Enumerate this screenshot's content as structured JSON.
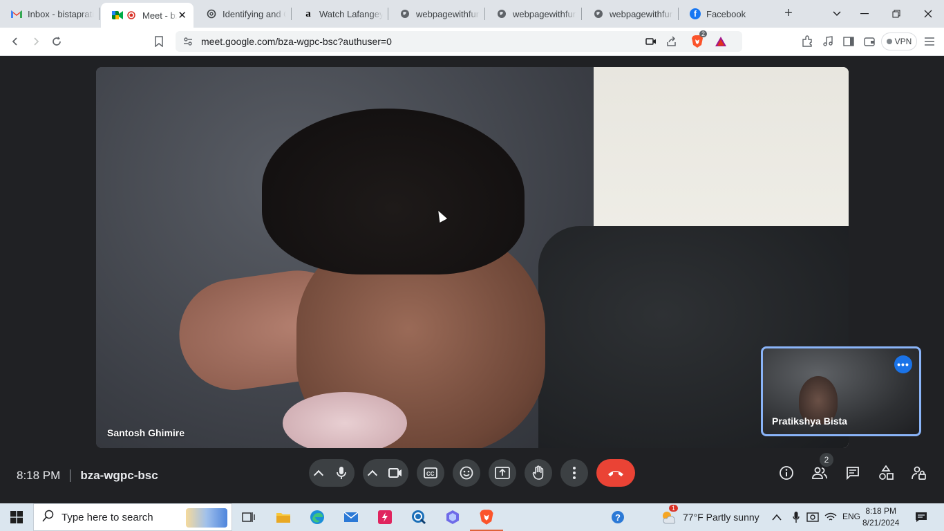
{
  "browser": {
    "tabs": [
      {
        "label": "Inbox - bistaprati",
        "icon": "gmail-icon",
        "active": false
      },
      {
        "label": "Meet - bz",
        "icon": "meet-icon",
        "active": true
      },
      {
        "label": "Identifying and C",
        "icon": "chatgpt-icon",
        "active": false
      },
      {
        "label": "Watch Lafangey P",
        "icon": "amazon-icon",
        "active": false
      },
      {
        "label": "webpagewithfun",
        "icon": "globe-icon",
        "active": false
      },
      {
        "label": "webpagewithfun",
        "icon": "globe-icon",
        "active": false
      },
      {
        "label": "webpagewithfun",
        "icon": "globe-icon",
        "active": false
      },
      {
        "label": "Facebook",
        "icon": "facebook-icon",
        "active": false
      }
    ],
    "url": "meet.google.com/bza-wgpc-bsc?authuser=0",
    "brave_badge": "2",
    "vpn_label": "VPN"
  },
  "meet": {
    "main_participant": "Santosh Ghimire",
    "self_participant": "Pratikshya Bista",
    "time": "8:18 PM",
    "meeting_code": "bza-wgpc-bsc",
    "people_count": "2",
    "colors": {
      "accent": "#8ab4f8",
      "hangup": "#ea4335",
      "more_button": "#1a73e8",
      "background": "#202124"
    }
  },
  "taskbar": {
    "search_placeholder": "Type here to search",
    "weather": "77°F  Partly sunny",
    "weather_badge": "1",
    "language": "ENG",
    "time": "8:18 PM",
    "date": "8/21/2024"
  }
}
